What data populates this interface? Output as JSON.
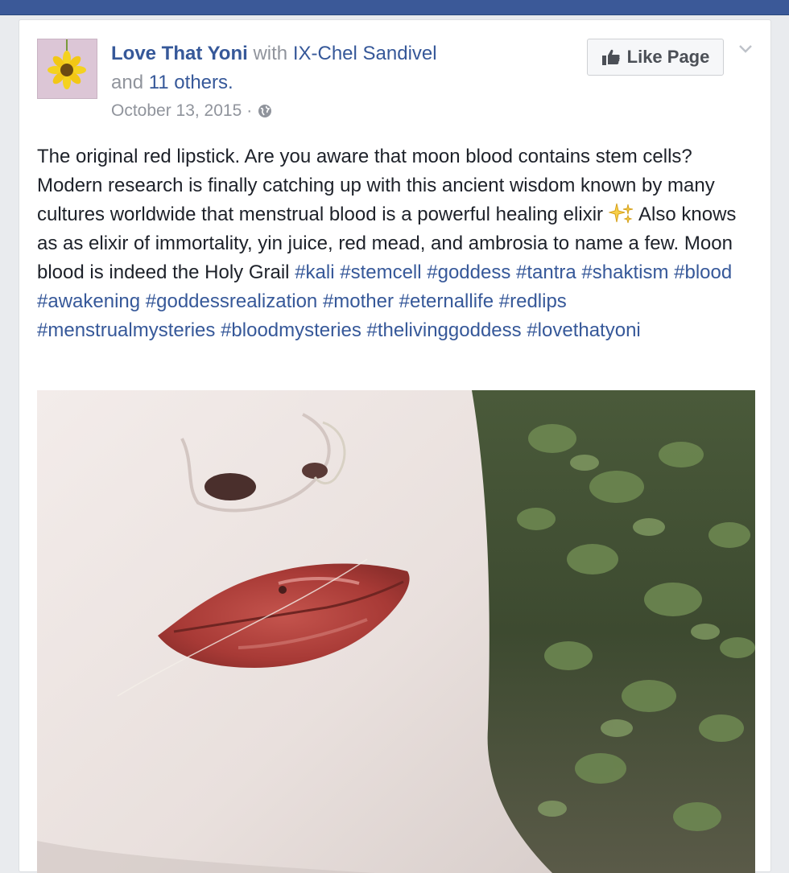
{
  "post": {
    "page_name": "Love That Yoni",
    "with_text": "with",
    "tagged_person": "IX-Chel Sandivel",
    "and_text": "and",
    "others": "11 others.",
    "date": "October 13, 2015",
    "dot": "·",
    "privacy_icon": "globe-icon",
    "like_page_label": "Like Page",
    "body_intro": "The original red lipstick. Are you aware that moon blood contains stem cells? Modern research is finally catching up with this ancient wisdom known by many cultures worldwide that menstrual blood is a powerful healing elixir",
    "body_rest": "Also knows as as elixir of immortality, yin juice, red mead, and ambrosia to name a few. Moon blood is indeed the Holy Grail",
    "hashtags": [
      "#kali",
      "#stemcell",
      "#goddess",
      "#tantra",
      "#shaktism",
      "#blood",
      "#awakening",
      "#goddessrealization",
      "#mother",
      "#eternallife",
      "#redlips",
      "#menstrualmysteries",
      "#bloodmysteries",
      "#thelivinggoddess",
      "#lovethatyoni"
    ]
  },
  "colors": {
    "topbar": "#3b5998",
    "link": "#365899",
    "meta": "#90949c",
    "text": "#1d2129",
    "background": "#e9ebee"
  }
}
